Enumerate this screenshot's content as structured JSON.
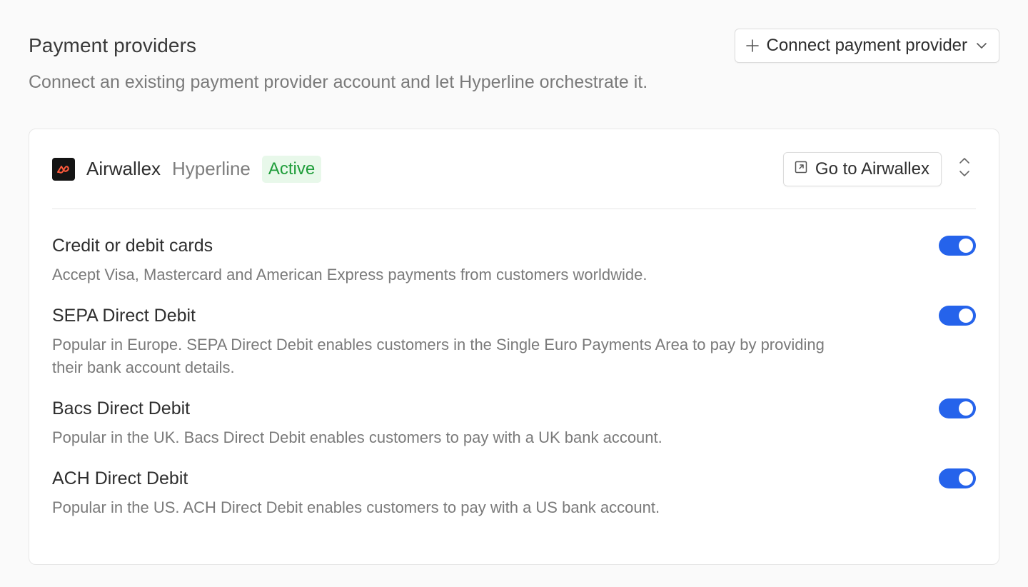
{
  "header": {
    "title": "Payment providers",
    "connect_button": "Connect payment provider",
    "subtitle": "Connect an existing payment provider account and let Hyperline orchestrate it."
  },
  "provider": {
    "name": "Airwallex",
    "account": "Hyperline",
    "status": "Active",
    "goto_button": "Go to Airwallex",
    "logo_icon": "airwallex-logo",
    "colors": {
      "status_text": "#1f9d3a",
      "status_bg": "#e8f8ea",
      "logo_bg": "#141414",
      "logo_mark": "#ff5a3c"
    }
  },
  "methods": [
    {
      "title": "Credit or debit cards",
      "description": "Accept Visa, Mastercard and American Express payments from customers worldwide.",
      "enabled": true
    },
    {
      "title": "SEPA Direct Debit",
      "description": "Popular in Europe. SEPA Direct Debit enables customers in the Single Euro Payments Area to pay by providing their bank account details.",
      "enabled": true
    },
    {
      "title": "Bacs Direct Debit",
      "description": "Popular in the UK. Bacs Direct Debit enables customers to pay with a UK bank account.",
      "enabled": true
    },
    {
      "title": "ACH Direct Debit",
      "description": "Popular in the US. ACH Direct Debit enables customers to pay with a US bank account.",
      "enabled": true
    }
  ],
  "colors": {
    "toggle_on": "#2563eb"
  },
  "icons": {
    "connect": "plus-icon",
    "dropdown": "chevron-down-icon",
    "external": "external-link-icon",
    "expand": "chevron-up-down-icon"
  }
}
